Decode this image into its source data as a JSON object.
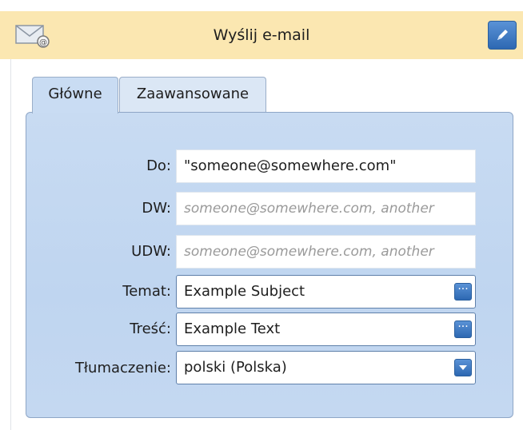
{
  "header": {
    "title": "Wyślij e-mail",
    "left_icon": "mail-icon",
    "right_button_icon": "pencil-icon"
  },
  "tabs": [
    {
      "label": "Główne",
      "active": true
    },
    {
      "label": "Zaawansowane",
      "active": false
    }
  ],
  "form": {
    "to": {
      "label": "Do:",
      "value": "\"someone@somewhere.com\""
    },
    "cc": {
      "label": "DW:",
      "placeholder": "someone@somewhere.com, another"
    },
    "bcc": {
      "label": "UDW:",
      "placeholder": "someone@somewhere.com, another"
    },
    "subject": {
      "label": "Temat:",
      "value": "Example Subject",
      "button_icon": "ellipsis-icon"
    },
    "body": {
      "label": "Treść:",
      "value": "Example Text",
      "button_icon": "ellipsis-icon"
    },
    "translation": {
      "label": "Tłumaczenie:",
      "value": "polski (Polska)",
      "button_icon": "dropdown-arrow-icon"
    }
  },
  "colors": {
    "header_bg": "#fbe7b1",
    "panel_bg": "#c8dbf2",
    "button_blue": "#2d68b2"
  }
}
